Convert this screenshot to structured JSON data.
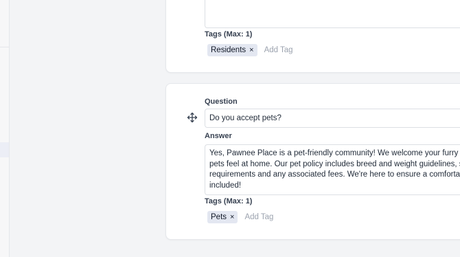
{
  "cards": [
    {
      "tags_label": "Tags (Max: 1)",
      "tags": [
        {
          "label": "Residents",
          "remove": "×"
        }
      ],
      "add_tag_placeholder": "Add Tag"
    },
    {
      "question_label": "Question",
      "question_value": "Do you accept pets?",
      "answer_label": "Answer",
      "answer_lines": [
        "Yes, Pawnee Place is a pet-friendly community! We welcome your furry comp",
        "pets feel at home. Our pet policy includes breed and weight guidelines, so pl",
        "requirements and any associated fees. We're here to ensure a comfortable li",
        "included!"
      ],
      "tags_label": "Tags (Max: 1)",
      "tags": [
        {
          "label": "Pets",
          "remove": "×"
        }
      ],
      "add_tag_placeholder": "Add Tag"
    }
  ],
  "icons": {
    "drag_handle": "move-arrows-icon"
  }
}
